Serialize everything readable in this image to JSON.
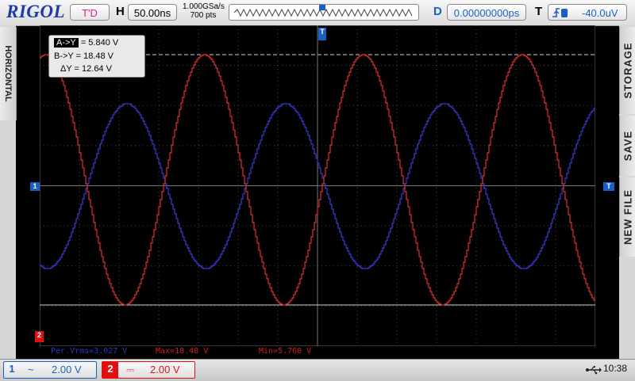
{
  "brand": "RIGOL",
  "top_bar": {
    "run_status": "T'D",
    "horizontal_label": "H",
    "timebase": "50.00ns",
    "sample_rate": "1.000GSa/s",
    "memory_depth": "700  pts",
    "delay_label": "D",
    "delay": "0.00000000ps",
    "trigger_label": "T",
    "trigger_source_icon": "rising-edge-ch1-icon",
    "trigger_level": "-40.0uV"
  },
  "left_panel": {
    "tab_label": "HORIZONTAL"
  },
  "right_panel": {
    "tabs": [
      "STORAGE",
      "SAVE",
      "NEW FILE"
    ]
  },
  "cursor_readout": {
    "a_label": "A->Y",
    "a_value": "= 5.840 V",
    "b_text": "B->Y = 18.48 V",
    "delta_text": "ΔY = 12.64 V"
  },
  "markers": {
    "ch1": "1",
    "ch2": "2",
    "trigger_level": "T",
    "trigger_position": "T"
  },
  "measurements": {
    "per_vrms": "Per.Vrms=3.027 V",
    "max": "Max=18.48 V",
    "min": "Min=5.760 V"
  },
  "bottom_bar": {
    "ch1_number": "1",
    "ch1_coupling_icon": "ac-coupling-icon",
    "ch1_scale": "2.00 V",
    "ch2_number": "2",
    "ch2_coupling_icon": "dc-coupling-icon",
    "ch2_scale": "2.00 V",
    "time": "10:38"
  },
  "colors": {
    "ch1": "#3a3ad8",
    "ch2": "#e03030",
    "grid": "#5a5a5a",
    "brand": "#1d3aa8"
  }
}
